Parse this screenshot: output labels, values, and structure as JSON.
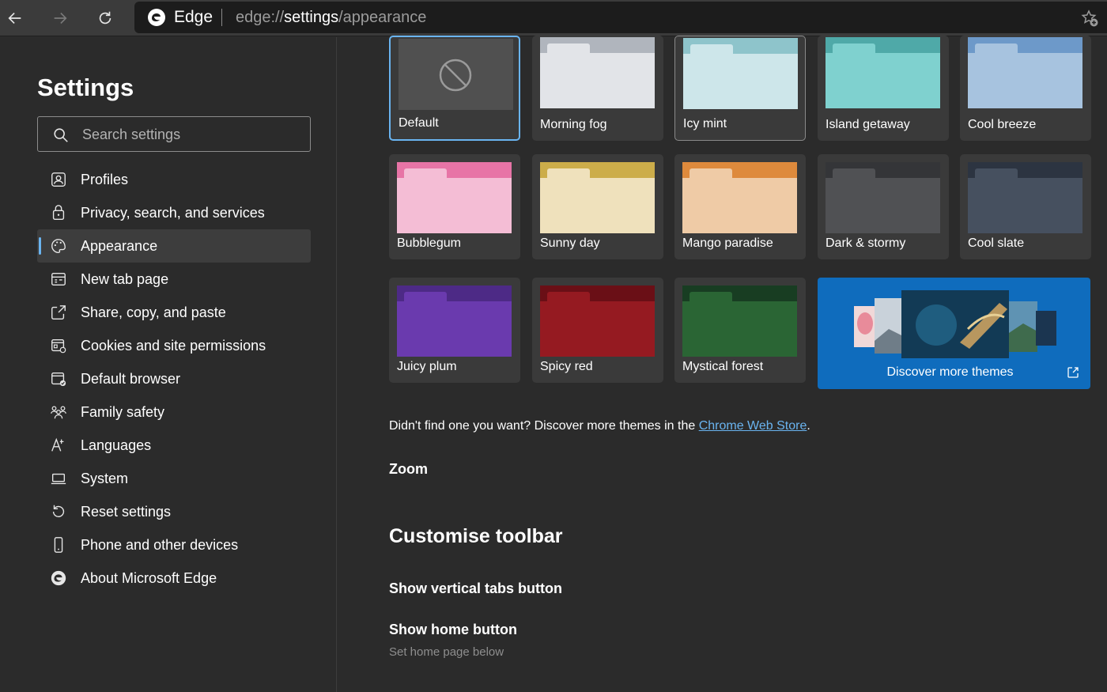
{
  "browser": {
    "app_name": "Edge",
    "url_prefix": "edge://",
    "url_host": "settings",
    "url_path": "/appearance",
    "icons": {
      "back": "arrow-left-icon",
      "forward": "arrow-right-icon",
      "refresh": "refresh-icon",
      "favorites": "star-add-icon"
    }
  },
  "sidebar": {
    "title": "Settings",
    "search_placeholder": "Search settings",
    "items": [
      {
        "label": "Profiles",
        "icon": "profile-icon",
        "active": false
      },
      {
        "label": "Privacy, search, and services",
        "icon": "lock-icon",
        "active": false
      },
      {
        "label": "Appearance",
        "icon": "palette-icon",
        "active": true
      },
      {
        "label": "New tab page",
        "icon": "new-tab-icon",
        "active": false
      },
      {
        "label": "Share, copy, and paste",
        "icon": "share-icon",
        "active": false
      },
      {
        "label": "Cookies and site permissions",
        "icon": "cookies-icon",
        "active": false
      },
      {
        "label": "Default browser",
        "icon": "default-browser-icon",
        "active": false
      },
      {
        "label": "Family safety",
        "icon": "family-icon",
        "active": false
      },
      {
        "label": "Languages",
        "icon": "languages-icon",
        "active": false
      },
      {
        "label": "System",
        "icon": "laptop-icon",
        "active": false
      },
      {
        "label": "Reset settings",
        "icon": "reset-icon",
        "active": false
      },
      {
        "label": "Phone and other devices",
        "icon": "phone-icon",
        "active": false
      },
      {
        "label": "About Microsoft Edge",
        "icon": "edge-logo-icon",
        "active": false
      }
    ]
  },
  "themes": [
    {
      "label": "Default",
      "top": "#4a4a4a",
      "tab": "#4a4a4a",
      "body": "#4a4a4a",
      "selected": true
    },
    {
      "label": "Morning fog",
      "top": "#b0b5bd",
      "tab": "#e2e4e8",
      "body": "#e2e4e8"
    },
    {
      "label": "Icy mint",
      "top": "#8ec4cb",
      "tab": "#cde6ea",
      "body": "#cde6ea",
      "hovered": true
    },
    {
      "label": "Island getaway",
      "top": "#4fa9a8",
      "tab": "#7fd1cf",
      "body": "#7fd1cf"
    },
    {
      "label": "Cool breeze",
      "top": "#6d99c9",
      "tab": "#a7c3df",
      "body": "#a7c3df"
    },
    {
      "label": "Bubblegum",
      "top": "#e774a6",
      "tab": "#f4bdd5",
      "body": "#f4bdd5"
    },
    {
      "label": "Sunny day",
      "top": "#ccad4a",
      "tab": "#efe1bc",
      "body": "#efe1bc"
    },
    {
      "label": "Mango paradise",
      "top": "#de8a3c",
      "tab": "#efcba6",
      "body": "#efcba6"
    },
    {
      "label": "Dark & stormy",
      "top": "#343538",
      "tab": "#505154",
      "body": "#505154"
    },
    {
      "label": "Cool slate",
      "top": "#2c3441",
      "tab": "#46505f",
      "body": "#46505f"
    },
    {
      "label": "Juicy plum",
      "top": "#4d2a86",
      "tab": "#6a3aae",
      "body": "#6a3aae"
    },
    {
      "label": "Spicy red",
      "top": "#6a0f16",
      "tab": "#951a21",
      "body": "#951a21"
    },
    {
      "label": "Mystical forest",
      "top": "#183d22",
      "tab": "#2a6534",
      "body": "#2a6534"
    }
  ],
  "discover": {
    "label": "Discover more themes",
    "icon": "external-link-icon"
  },
  "store": {
    "text": "Didn't find one you want? Discover more themes in the ",
    "link": "Chrome Web Store",
    "suffix": "."
  },
  "zoom_heading": "Zoom",
  "toolbar": {
    "heading": "Customise toolbar",
    "vertical_tabs": "Show vertical tabs button",
    "home_button": "Show home button",
    "home_sub": "Set home page below"
  },
  "colors": {
    "accent": "#6ab4f0",
    "discover_bg": "#0f6cbd",
    "page_bg": "#2b2b2b"
  }
}
